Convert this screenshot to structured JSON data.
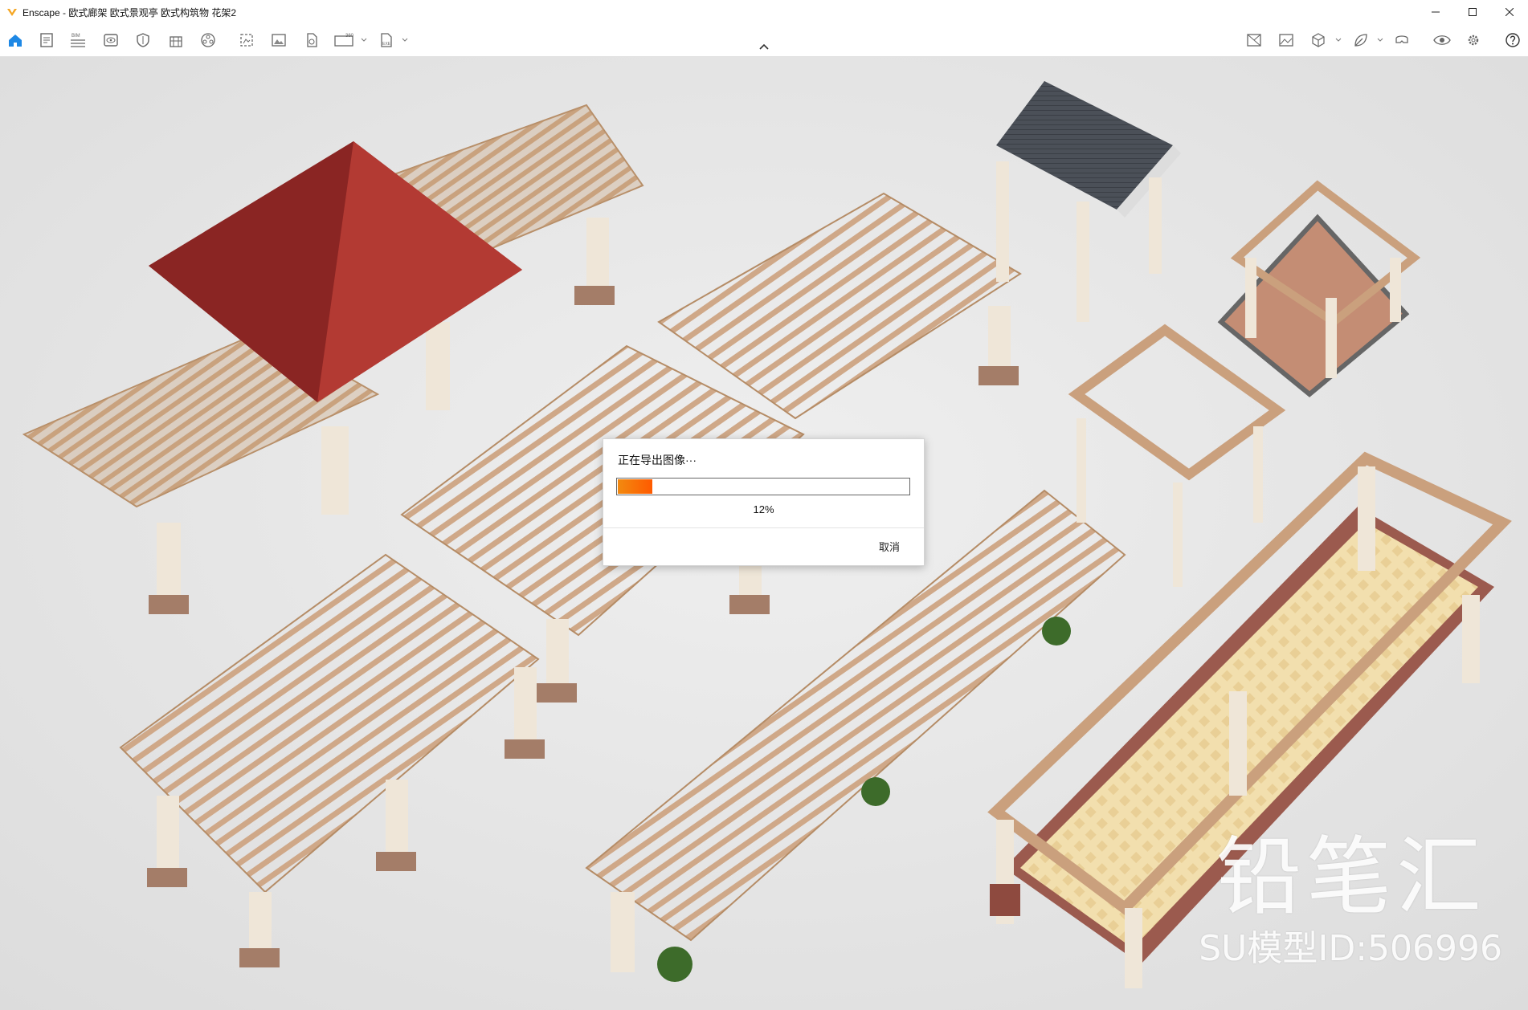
{
  "window": {
    "title": "Enscape - 欧式廊架 欧式景观亭 欧式构筑物 花架2",
    "controls": [
      "minimize-icon",
      "maximize-icon",
      "close-icon"
    ]
  },
  "toolbar": {
    "left_icons": [
      "home-icon",
      "document-icon",
      "bim-icon",
      "visibility-icon",
      "shield-icon",
      "building-icon",
      "materials-icon",
      "batch-render-icon",
      "image-icon",
      "export-document-icon",
      "panorama-360-icon",
      "exe-export-icon"
    ],
    "bim_label": "BIM",
    "pano_label": "360",
    "exe_label": "EXE",
    "right_icons": [
      "map-icon",
      "landscape-icon",
      "cube-icon",
      "leaf-icon",
      "vr-headset-icon",
      "eye-icon",
      "settings-icon",
      "help-icon"
    ],
    "accent_color": "#1e88e5"
  },
  "dialog": {
    "title": "正在导出图像···",
    "progress_value": 0.12,
    "progress_text": "12%",
    "cancel_label": "取消"
  },
  "watermark": {
    "brand": "铅笔汇",
    "model_id": "SU模型ID:506996"
  }
}
